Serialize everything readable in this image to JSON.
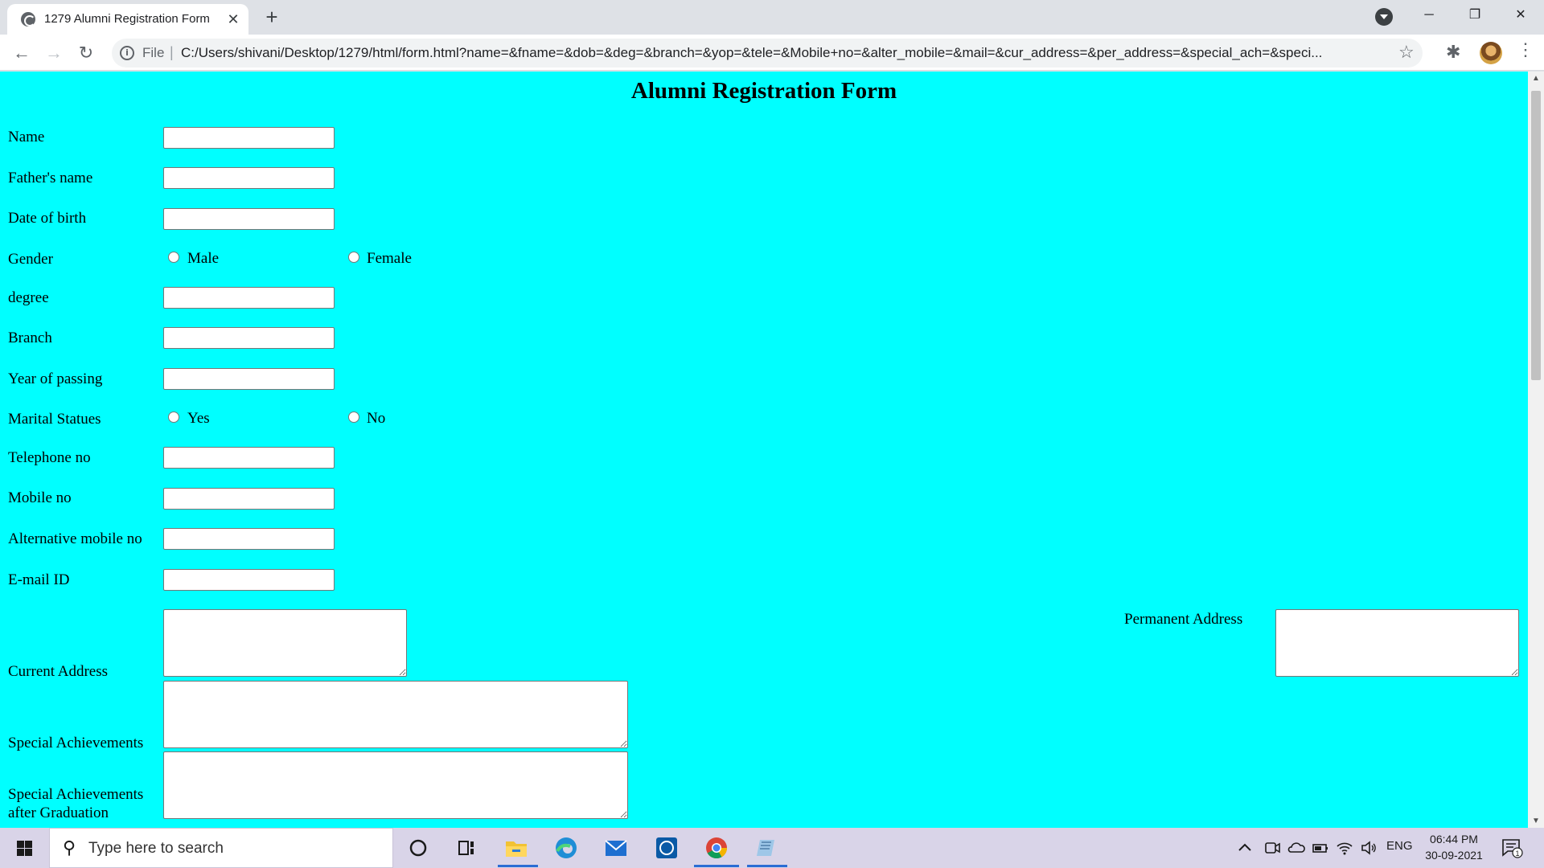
{
  "browser": {
    "tab_title": "1279 Alumni Registration Form",
    "tab_close": "✕",
    "new_tab": "+",
    "url_scheme": "File",
    "url_separator": "|",
    "url": "C:/Users/shivani/Desktop/1279/html/form.html?name=&fname=&dob=&deg=&branch=&yop=&tele=&Mobile+no=&alter_mobile=&mail=&cur_address=&per_address=&special_ach=&speci...",
    "window": {
      "minimize": "─",
      "restore": "❐",
      "close": "✕"
    },
    "nav": {
      "back": "←",
      "forward": "→",
      "reload": "↻"
    },
    "icons": {
      "info": "i",
      "star": "☆",
      "extensions": "✱",
      "menu": "⋮"
    }
  },
  "page": {
    "title": "Alumni Registration Form",
    "fields": [
      {
        "label": "Name",
        "value": ""
      },
      {
        "label": "Father's name",
        "value": ""
      },
      {
        "label": "Date of birth",
        "value": ""
      },
      {
        "label": "degree",
        "value": ""
      },
      {
        "label": "Branch",
        "value": ""
      },
      {
        "label": "Year of passing",
        "value": ""
      },
      {
        "label": "Telephone no",
        "value": ""
      },
      {
        "label": "Mobile no",
        "value": ""
      },
      {
        "label": "Alternative mobile no",
        "value": ""
      },
      {
        "label": "E-mail ID",
        "value": ""
      }
    ],
    "gender": {
      "label": "Gender",
      "options": [
        "Male",
        "Female"
      ],
      "selected": null
    },
    "marital": {
      "label": "Marital Statues",
      "options": [
        "Yes",
        "No"
      ],
      "selected": null
    },
    "current_address": {
      "label": "Current Address",
      "value": ""
    },
    "permanent_address": {
      "label": "Permanent Address",
      "value": ""
    },
    "special_achievements": {
      "label": "Special Achievements",
      "value": ""
    },
    "special_after": {
      "label_line1": "Special Achievements",
      "label_line2": "after Graduation",
      "value": ""
    }
  },
  "scrollbar": {
    "up": "▲",
    "down": "▼"
  },
  "taskbar": {
    "search_placeholder": "Type here to search",
    "language": "ENG",
    "time": "06:44 PM",
    "date": "30-09-2021",
    "notification_count": "1"
  },
  "colors": {
    "page_bg": "#00ffff",
    "taskbar_bg": "#d9d4e8",
    "chrome_bg": "#dee1e6"
  }
}
